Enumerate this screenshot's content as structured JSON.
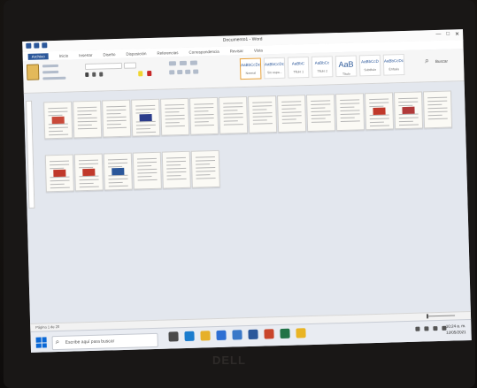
{
  "window": {
    "doc_title": "Documento1 - Word",
    "controls": [
      "—",
      "□",
      "✕"
    ]
  },
  "ribbon": {
    "tabs": [
      "Archivo",
      "Inicio",
      "Insertar",
      "Diseño",
      "Disposición",
      "Referencias",
      "Correspondencia",
      "Revisar",
      "Vista"
    ],
    "paste_label": "Pegar",
    "styles": [
      {
        "sample": "AaBbCcDc",
        "name": "Normal",
        "selected": true
      },
      {
        "sample": "AaBbCcDc",
        "name": "Sin espa..."
      },
      {
        "sample": "AaBbC",
        "name": "Título 1"
      },
      {
        "sample": "AaBbCc",
        "name": "Título 2"
      },
      {
        "sample": "AaB",
        "name": "Título"
      },
      {
        "sample": "AaBbCcD",
        "name": "Subtítulo"
      },
      {
        "sample": "AaBbCcDc",
        "name": "Énfasis"
      }
    ],
    "find_label": "Buscar"
  },
  "document": {
    "pages": 20
  },
  "statusbar": {
    "page_info": "Página 1 de 20",
    "zoom_percent": 10
  },
  "taskbar": {
    "search_placeholder": "Escribe aquí para buscar",
    "apps": [
      {
        "icon": "task-view-icon",
        "color": "#4a4a4a"
      },
      {
        "icon": "edge-icon",
        "color": "#1b7ccd"
      },
      {
        "icon": "explorer-icon",
        "color": "#e6b02a"
      },
      {
        "icon": "store-icon",
        "color": "#2e6fd3"
      },
      {
        "icon": "mail-icon",
        "color": "#3a78c8"
      },
      {
        "icon": "word-icon",
        "color": "#2b579a"
      },
      {
        "icon": "powerpoint-icon",
        "color": "#c9452b"
      },
      {
        "icon": "excel-icon",
        "color": "#217346"
      },
      {
        "icon": "chrome-icon",
        "color": "#e9b424"
      }
    ],
    "clock_time": "10:24 a. m.",
    "clock_date": "12/05/2021"
  },
  "bezel": {
    "brand": "DELL"
  },
  "colors": {
    "word_blue": "#2b579a",
    "start_blue": "#0a68d6"
  }
}
